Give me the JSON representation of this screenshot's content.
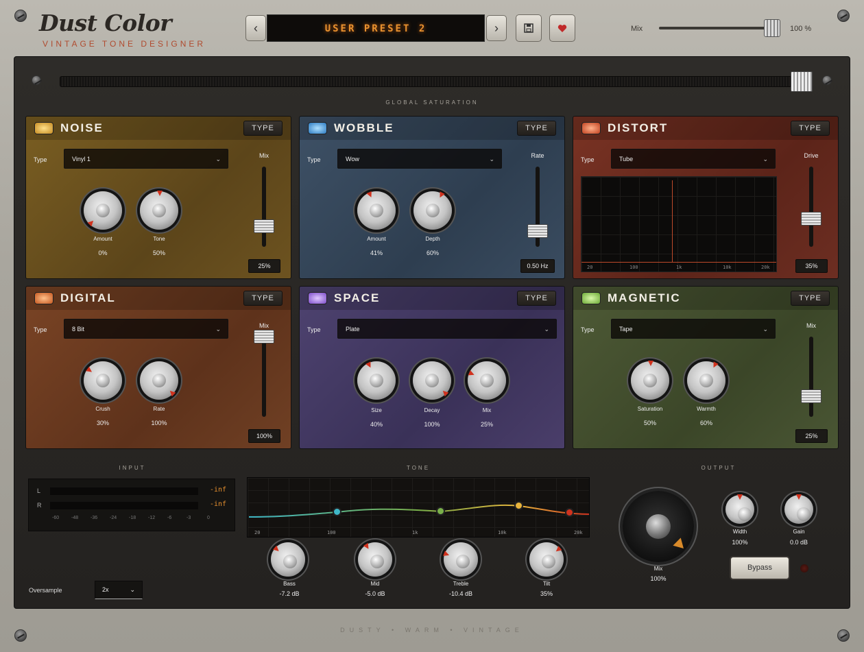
{
  "header": {
    "logo": "Dust Color",
    "subtitle": "VINTAGE TONE DESIGNER",
    "preset_name": "USER PRESET 2",
    "prev_label": "‹",
    "next_label": "›",
    "mix_label": "Mix",
    "mix_value": "100 %",
    "mix_level": 1.0
  },
  "global": {
    "caption": "GLOBAL SATURATION",
    "level": 0.97
  },
  "panels": {
    "noise": {
      "title": "NOISE",
      "type_btn": "TYPE",
      "type_label": "Type",
      "type_value": "Vinyl 1",
      "led_color": "#e8b43c",
      "knobs": [
        {
          "label": "Amount",
          "value": "0%",
          "level": 0.0
        },
        {
          "label": "Tone",
          "value": "50%",
          "level": 0.5
        }
      ],
      "slider": {
        "label": "Mix",
        "value": "25%",
        "level": 0.25
      }
    },
    "wobble": {
      "title": "WOBBLE",
      "type_btn": "TYPE",
      "type_label": "Type",
      "type_value": "Wow",
      "led_color": "#4aa4e8",
      "knobs": [
        {
          "label": "Amount",
          "value": "41%",
          "level": 0.41
        },
        {
          "label": "Depth",
          "value": "60%",
          "level": 0.6
        }
      ],
      "slider": {
        "label": "Rate",
        "value": "0.50 Hz",
        "level": 0.2
      }
    },
    "distort": {
      "title": "DISTORT",
      "type_btn": "TYPE",
      "type_label": "Type",
      "type_value": "Tube",
      "led_color": "#e8643c",
      "graph_ticks": [
        "20",
        "100",
        "1k",
        "10k",
        "20k"
      ],
      "slider": {
        "label": "Drive",
        "value": "35%",
        "level": 0.35
      }
    },
    "digital": {
      "title": "DIGITAL",
      "type_btn": "TYPE",
      "type_label": "Type",
      "type_value": "8 Bit",
      "led_color": "#ec7a34",
      "knobs": [
        {
          "label": "Crush",
          "value": "30%",
          "level": 0.3
        },
        {
          "label": "Rate",
          "value": "100%",
          "level": 1.0
        }
      ],
      "slider": {
        "label": "Mix",
        "value": "100%",
        "level": 1.0
      }
    },
    "space": {
      "title": "SPACE",
      "type_btn": "TYPE",
      "type_label": "Type",
      "type_value": "Plate",
      "led_color": "#a07ae8",
      "knobs": [
        {
          "label": "Size",
          "value": "40%",
          "level": 0.4
        },
        {
          "label": "Decay",
          "value": "100%",
          "level": 1.0
        },
        {
          "label": "Mix",
          "value": "25%",
          "level": 0.25
        }
      ]
    },
    "magnetic": {
      "title": "MAGNETIC",
      "type_btn": "TYPE",
      "type_label": "Type",
      "type_value": "Tape",
      "led_color": "#8cc84a",
      "knobs": [
        {
          "label": "Saturation",
          "value": "50%",
          "level": 0.5
        },
        {
          "label": "Warmth",
          "value": "60%",
          "level": 0.6
        }
      ],
      "slider": {
        "label": "Mix",
        "value": "25%",
        "level": 0.25
      }
    }
  },
  "input": {
    "caption": "INPUT",
    "l_label": "L",
    "r_label": "R",
    "l_value": "-inf",
    "r_value": "-inf",
    "scale": [
      "-60",
      "-48",
      "-36",
      "-24",
      "-18",
      "-12",
      "-6",
      "-3",
      "0"
    ]
  },
  "tone": {
    "caption": "TONE",
    "freq_ticks": [
      "20",
      "100",
      "1k",
      "10k",
      "20k"
    ],
    "knobs": [
      {
        "label": "Bass",
        "value": "-7.2 dB",
        "level": 0.32
      },
      {
        "label": "Mid",
        "value": "-5.0 dB",
        "level": 0.38
      },
      {
        "label": "Treble",
        "value": "-10.4 dB",
        "level": 0.24
      },
      {
        "label": "Tilt",
        "value": "35%",
        "level": 0.68
      }
    ],
    "node_colors": [
      "#3fb8c8",
      "#7ab04a",
      "#e8b43c",
      "#d0321e"
    ]
  },
  "output": {
    "caption": "OUTPUT",
    "mix_label": "Mix",
    "mix_value": "100%",
    "width_label": "Width",
    "width_value": "100%",
    "gain_label": "Gain",
    "gain_value": "0.0 dB",
    "bypass": "Bypass"
  },
  "oversample": {
    "label": "Oversample",
    "value": "2x"
  },
  "footer": "DUSTY • WARM • VINTAGE"
}
